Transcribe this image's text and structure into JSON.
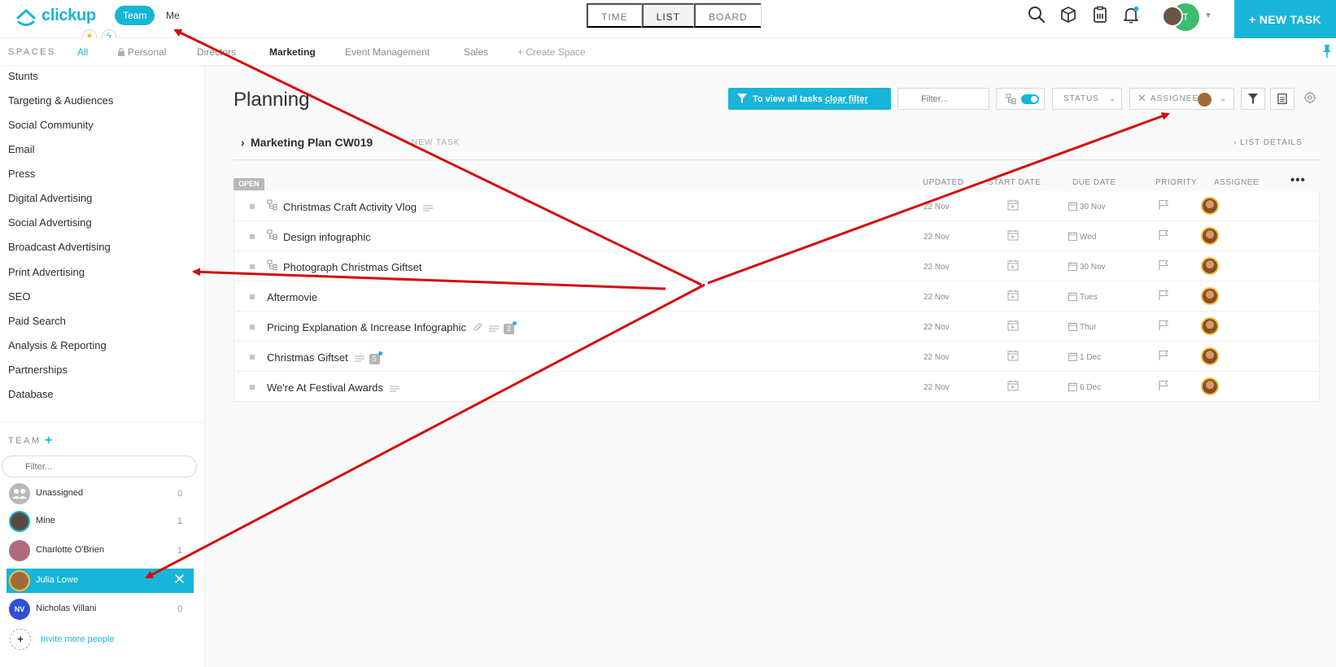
{
  "header": {
    "logo_text": "clickup",
    "segments": [
      "Team",
      "Me"
    ],
    "views": [
      "TIME",
      "LIST",
      "BOARD"
    ],
    "active_view": "LIST",
    "avatar_initials": "T",
    "new_task_label": "+ NEW TASK",
    "colors": {
      "accent": "#18b5d8",
      "avatar_green": "#3dbb6e"
    }
  },
  "spaces": {
    "label": "SPACES",
    "tabs": [
      "All",
      "Personal",
      "Directors",
      "Marketing",
      "Event Management",
      "Sales",
      "+ Create Space"
    ],
    "active_tab": "All"
  },
  "sidebar": {
    "lists": [
      "Stunts",
      "Targeting & Audiences",
      "Social Community",
      "Email",
      "Press",
      "Digital Advertising",
      "Social Advertising",
      "Broadcast Advertising",
      "Print Advertising",
      "SEO",
      "Paid Search",
      "Analysis & Reporting",
      "Partnerships",
      "Database"
    ],
    "team_label": "TEAM",
    "team_filter_placeholder": "Filter...",
    "members": [
      {
        "name": "Unassigned",
        "count": "0"
      },
      {
        "name": "Mine",
        "count": "1"
      },
      {
        "name": "Charlotte O'Brien",
        "count": "1"
      },
      {
        "name": "Julia Lowe",
        "count": ""
      },
      {
        "name": "Nicholas Villani",
        "count": "0",
        "initials": "NV"
      }
    ],
    "invite_label": "Invite more people"
  },
  "main": {
    "title": "Planning",
    "clear_filter_prefix": "To view all tasks ",
    "clear_filter_link": "clear filter",
    "filter_placeholder": "Filter...",
    "status_label": "STATUS",
    "assignee_label": "ASSIGNEE",
    "list_name": "Marketing Plan CW019",
    "list_new_task": "NEW TASK",
    "list_details": "LIST DETAILS",
    "status_group": "OPEN",
    "columns": [
      "UPDATED",
      "START DATE",
      "DUE DATE",
      "PRIORITY",
      "ASSIGNEE"
    ],
    "tasks": [
      {
        "name": "Christmas Craft Activity Vlog",
        "updated": "22 Nov",
        "due": "30 Nov"
      },
      {
        "name": "Design infographic",
        "updated": "22 Nov",
        "due": "Wed"
      },
      {
        "name": "Photograph Christmas Giftset",
        "updated": "22 Nov",
        "due": "30 Nov"
      },
      {
        "name": "Aftermovie",
        "updated": "22 Nov",
        "due": "Tues"
      },
      {
        "name": "Pricing Explanation & Increase Infographic",
        "updated": "22 Nov",
        "due": "Thur",
        "count": "2"
      },
      {
        "name": "Christmas Giftset",
        "updated": "22 Nov",
        "due": "1 Dec",
        "count": "5"
      },
      {
        "name": "We're At Festival Awards",
        "updated": "22 Nov",
        "due": "6 Dec"
      }
    ]
  }
}
